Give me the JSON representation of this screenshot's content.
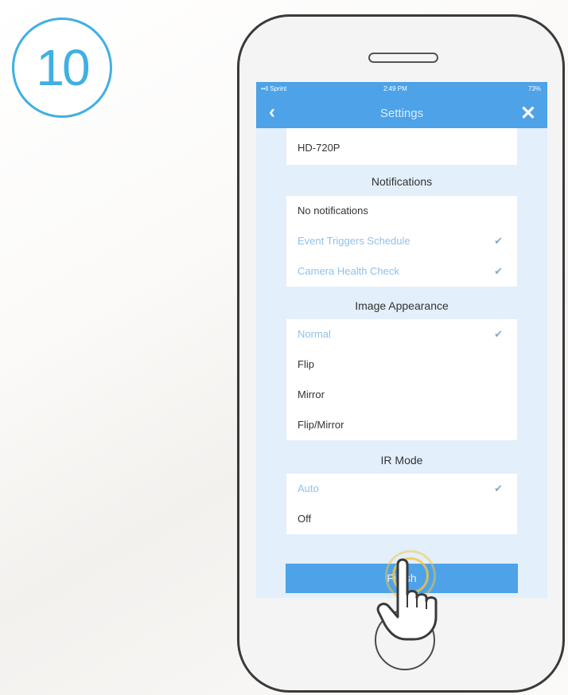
{
  "step": {
    "number": "10"
  },
  "status_bar": {
    "carrier": "••ll Sprint",
    "time": "2:49 PM",
    "battery": "73%"
  },
  "nav": {
    "back_icon": "‹",
    "title": "Settings",
    "close_icon": "✕"
  },
  "resolution": {
    "value": "HD-720P"
  },
  "notifications": {
    "title": "Notifications",
    "items": [
      {
        "label": "No notifications",
        "selected": false
      },
      {
        "label": "Event Triggers Schedule",
        "selected": true
      },
      {
        "label": "Camera Health Check",
        "selected": true
      }
    ]
  },
  "image_appearance": {
    "title": "Image Appearance",
    "items": [
      {
        "label": "Normal",
        "selected": true
      },
      {
        "label": "Flip",
        "selected": false
      },
      {
        "label": "Mirror",
        "selected": false
      },
      {
        "label": "Flip/Mirror",
        "selected": false
      }
    ]
  },
  "ir_mode": {
    "title": "IR Mode",
    "items": [
      {
        "label": "Auto",
        "selected": true
      },
      {
        "label": "Off",
        "selected": false
      }
    ]
  },
  "finish": {
    "label": "Finish"
  },
  "check_glyph": "✔",
  "colors": {
    "accent": "#4da2e8",
    "badge": "#3fb0e3",
    "selected_text": "#8fc1ee",
    "tap_ring": "#f4c542"
  }
}
